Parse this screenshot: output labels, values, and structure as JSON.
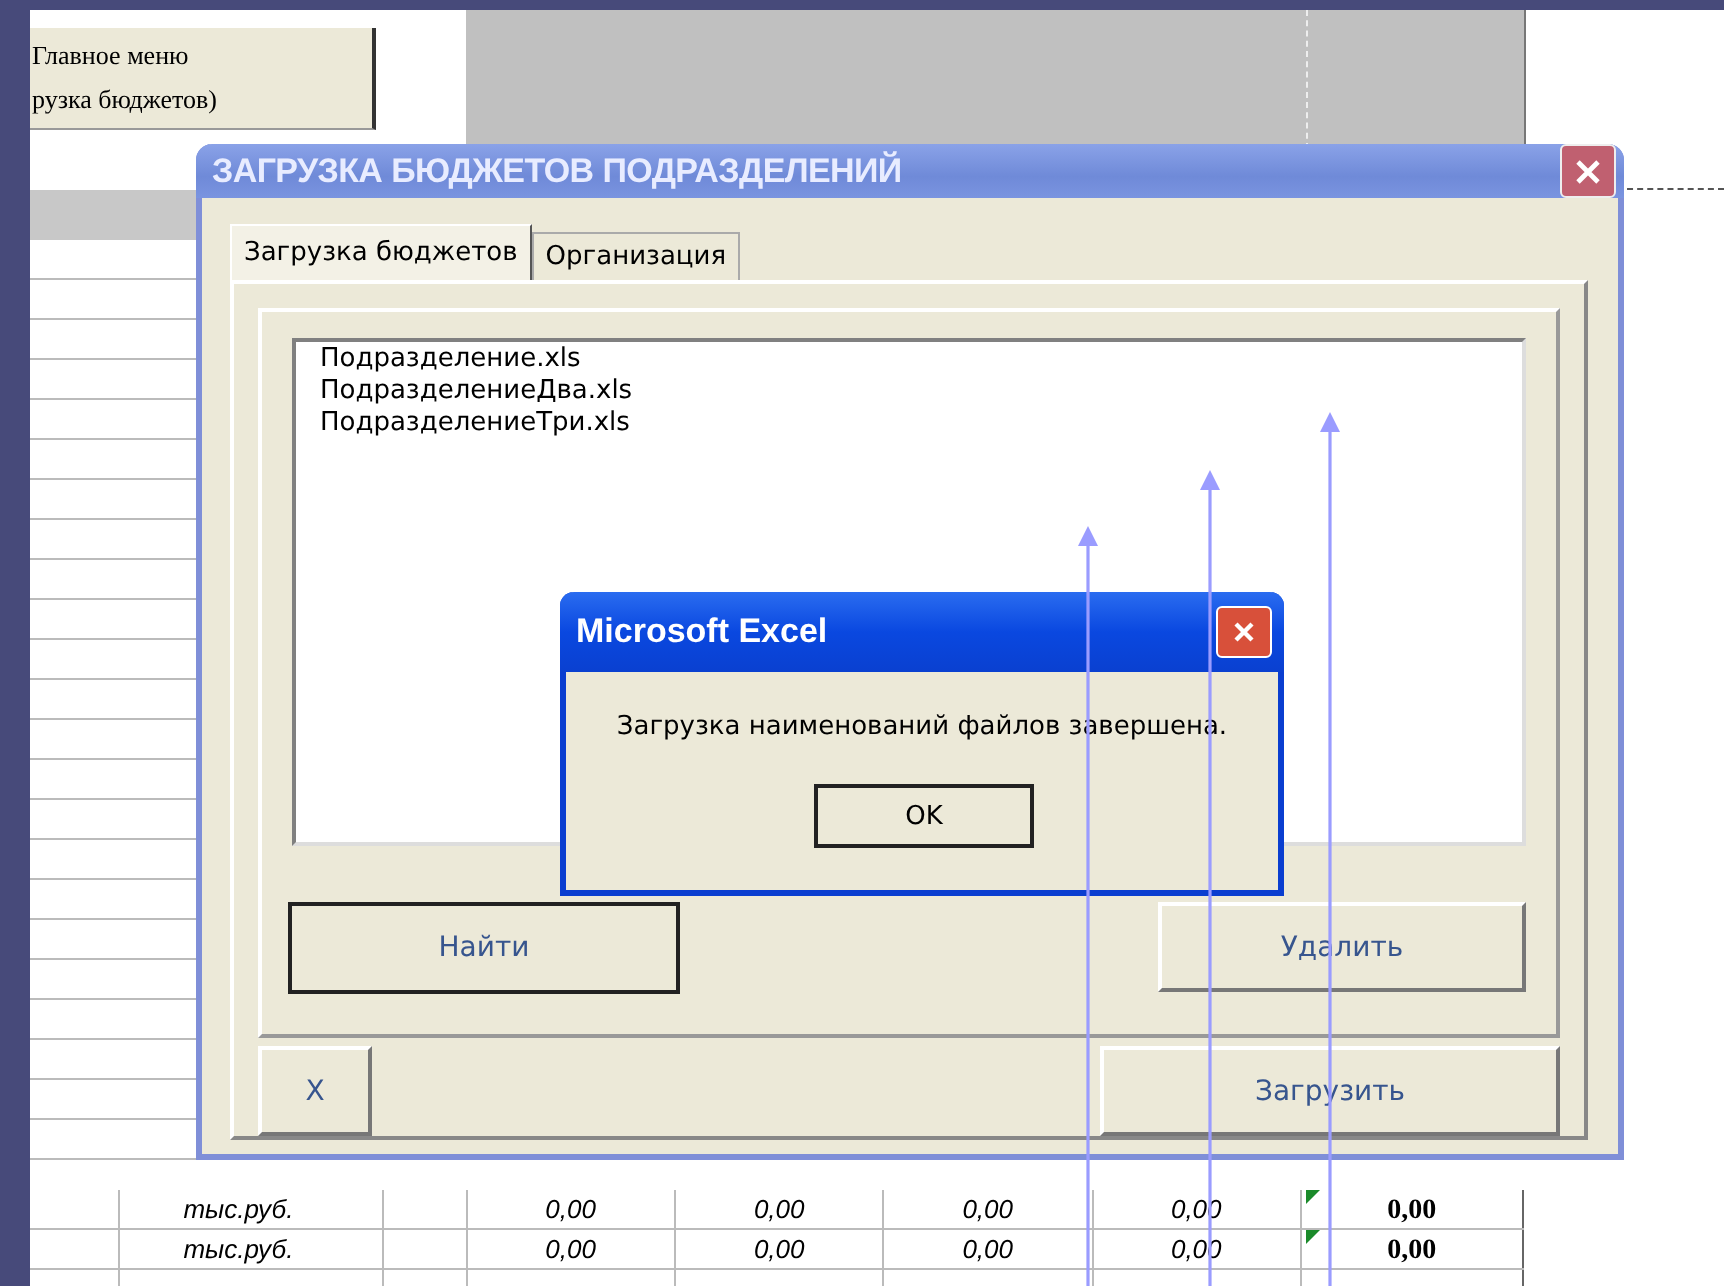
{
  "sheet": {
    "menu_button": [
      "Главное меню",
      "рузка бюджетов)"
    ],
    "rows": [
      {
        "unit": "тыс.руб.",
        "values": [
          "0,00",
          "0,00",
          "0,00",
          "0,00"
        ],
        "total": "0,00",
        "flagged": true
      },
      {
        "unit": "тыс.руб.",
        "values": [
          "0,00",
          "0,00",
          "0,00",
          "0,00"
        ],
        "total": "0,00",
        "flagged": true
      }
    ]
  },
  "dialog": {
    "title": "ЗАГРУЗКА БЮДЖЕТОВ ПОДРАЗДЕЛЕНИЙ",
    "tabs": [
      {
        "label": "Загрузка бюджетов",
        "selected": true
      },
      {
        "label": "Организация",
        "selected": false
      }
    ],
    "files": [
      "Подразделение.xls",
      "ПодразделениеДва.xls",
      "ПодразделениеТри.xls"
    ],
    "find_button": "Найти",
    "delete_button": "Удалить",
    "close_button": "X",
    "load_button": "Загрузить"
  },
  "message_box": {
    "title": "Microsoft Excel",
    "text": "Загрузка наименований файлов завершена.",
    "button": "OK"
  }
}
